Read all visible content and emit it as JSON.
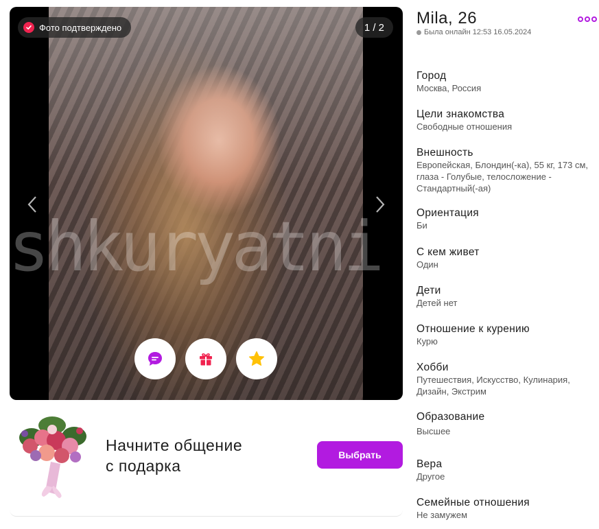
{
  "photo": {
    "verified_label": "Фото подтверждено",
    "counter": "1 / 2",
    "watermark": "shkuryatni",
    "prev_icon": "chevron-left-icon",
    "next_icon": "chevron-right-icon",
    "actions": [
      {
        "icon": "message-icon",
        "color": "#b21be0"
      },
      {
        "icon": "gift-icon",
        "color": "#f0234f"
      },
      {
        "icon": "star-icon",
        "color": "#ffc107"
      }
    ]
  },
  "gift_promo": {
    "title_line1": "Начните общение",
    "title_line2": "с подарка",
    "button_label": "Выбрать"
  },
  "profile": {
    "name": "Mila, 26",
    "last_seen": "Была онлайн 12:53 16.05.2024",
    "fields": [
      {
        "label": "Город",
        "value": "Москва, Россия"
      },
      {
        "label": "Цели знакомства",
        "value": "Свободные отношения"
      },
      {
        "label": "Внешность",
        "value": "Европейская, Блондин(-ка), 55 кг, 173 см,\nглаза - Голубые, телосложение -\nСтандартный(-ая)"
      },
      {
        "label": "Ориентация",
        "value": "Би"
      },
      {
        "label": "С кем живет",
        "value": "Один"
      },
      {
        "label": "Дети",
        "value": "Детей нет"
      },
      {
        "label": "Отношение к курению",
        "value": "Курю"
      },
      {
        "label": "Хобби",
        "value": "Путешествия, Искусство, Кулинария,\nДизайн, Экстрим"
      },
      {
        "label": "Образование",
        "value": "Высшее"
      },
      {
        "label": "Вера",
        "value": "Другое"
      },
      {
        "label": "Семейные отношения",
        "value": "Не замужем"
      }
    ]
  },
  "colors": {
    "accent": "#b21be0",
    "verified": "#f0234f"
  }
}
